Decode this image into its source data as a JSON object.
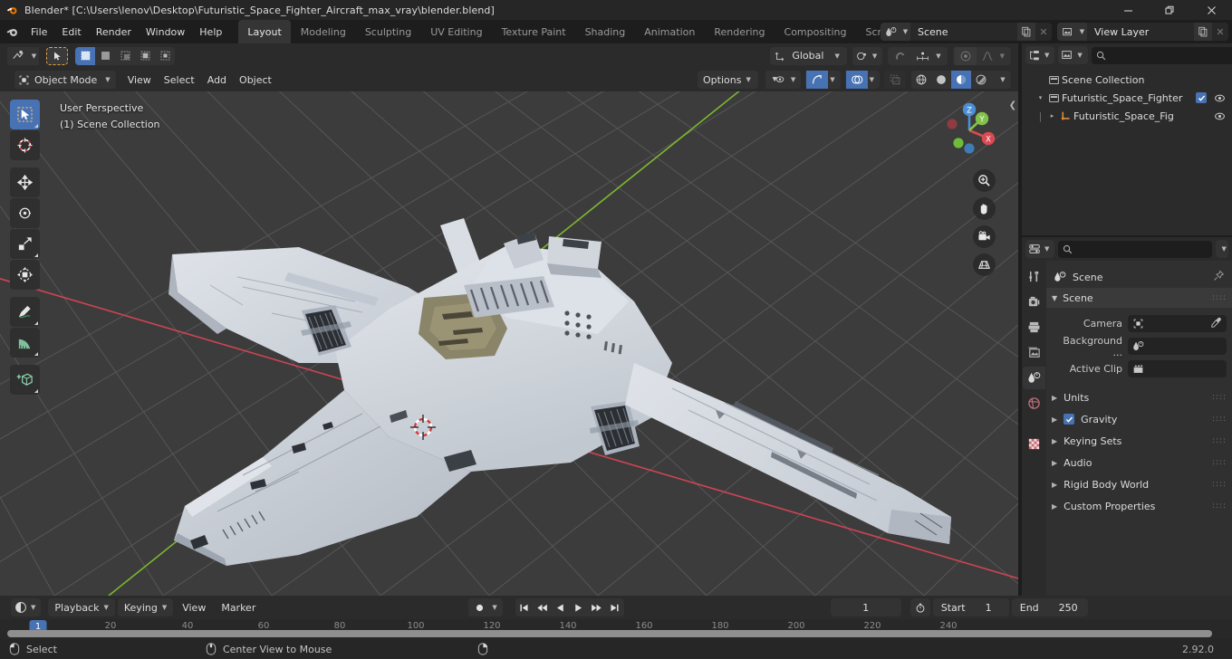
{
  "window": {
    "title": "Blender* [C:\\Users\\lenov\\Desktop\\Futuristic_Space_Fighter_Aircraft_max_vray\\blender.blend]",
    "minimize_label": "—",
    "restore_label": "❐",
    "close_label": "✕"
  },
  "topbar": {
    "menus": [
      "File",
      "Edit",
      "Render",
      "Window",
      "Help"
    ],
    "workspaces": [
      {
        "label": "Layout",
        "active": true
      },
      {
        "label": "Modeling",
        "active": false
      },
      {
        "label": "Sculpting",
        "active": false
      },
      {
        "label": "UV Editing",
        "active": false
      },
      {
        "label": "Texture Paint",
        "active": false
      },
      {
        "label": "Shading",
        "active": false
      },
      {
        "label": "Animation",
        "active": false
      },
      {
        "label": "Rendering",
        "active": false
      },
      {
        "label": "Compositing",
        "active": false
      },
      {
        "label": "Scripting",
        "active": false
      }
    ],
    "add_workspace_label": "+",
    "scene_name": "Scene",
    "view_layer_name": "View Layer"
  },
  "viewport_header": {
    "mode": "Object Mode",
    "menus": [
      "View",
      "Select",
      "Add",
      "Object"
    ],
    "transform_orientation": "Global",
    "options_label": "Options",
    "accent_color": "#4772b3"
  },
  "viewport": {
    "overlay_line1": "User Perspective",
    "overlay_line2": "(1) Scene Collection",
    "gizmo_axes": [
      "X",
      "Y",
      "Z"
    ],
    "background_color": "#3c3c3c",
    "grid_color": "#5c5c5c",
    "x_axis_color": "#cf4455",
    "y_axis_color": "#7db72f",
    "model_color": "#ccd2d9",
    "tools": [
      "tweak-select-tool",
      "cursor-tool",
      "move-tool",
      "rotate-tool",
      "scale-tool",
      "transform-tool",
      "annotate-tool",
      "measure-tool",
      "add-cube-tool"
    ],
    "nav_buttons": [
      "zoom",
      "pan",
      "camera",
      "toggle-ortho"
    ]
  },
  "outliner": {
    "search_placeholder": "",
    "rows": [
      {
        "label": "Scene Collection",
        "indent": 0,
        "icon": "collection",
        "disclosure": "",
        "checkbox": false,
        "eye": true
      },
      {
        "label": "Futuristic_Space_Fighter",
        "indent": 1,
        "icon": "collection",
        "disclosure": "▾",
        "checkbox": true,
        "eye": true
      },
      {
        "label": "Futuristic_Space_Fig",
        "indent": 2,
        "icon": "object",
        "disclosure": "▸",
        "checkbox": false,
        "eye": true
      }
    ]
  },
  "properties": {
    "search_placeholder": "",
    "tabs": [
      "tool",
      "render",
      "output",
      "view-layer",
      "scene",
      "world",
      "texture"
    ],
    "active_tab": "scene",
    "breadcrumb": "Scene",
    "panel_title": "Scene",
    "fields": [
      {
        "label": "Camera",
        "value": "",
        "icon": "camera-data-icon"
      },
      {
        "label": "Background ...",
        "value": "",
        "icon": "scene-icon"
      },
      {
        "label": "Active Clip",
        "value": "",
        "icon": "clip-icon"
      }
    ],
    "collapsed_panels": [
      {
        "label": "Units",
        "checkbox": false
      },
      {
        "label": "Gravity",
        "checkbox": true
      },
      {
        "label": "Keying Sets",
        "checkbox": false
      },
      {
        "label": "Audio",
        "checkbox": false
      },
      {
        "label": "Rigid Body World",
        "checkbox": false
      },
      {
        "label": "Custom Properties",
        "checkbox": false
      }
    ]
  },
  "timeline": {
    "menus": [
      "Playback",
      "Keying",
      "View",
      "Marker"
    ],
    "current_frame": "1",
    "start_label": "Start",
    "start_value": "1",
    "end_label": "End",
    "end_value": "250",
    "ticks": [
      "20",
      "40",
      "60",
      "80",
      "100",
      "120",
      "140",
      "160",
      "180",
      "200",
      "220",
      "240"
    ],
    "playhead_label": "1"
  },
  "statusbar": {
    "items": [
      {
        "icon": "mouse-left-icon",
        "label": "Select"
      },
      {
        "icon": "mouse-middle-icon",
        "label": "Center View to Mouse"
      },
      {
        "icon": "mouse-right-icon",
        "label": ""
      }
    ],
    "version": "2.92.0"
  }
}
